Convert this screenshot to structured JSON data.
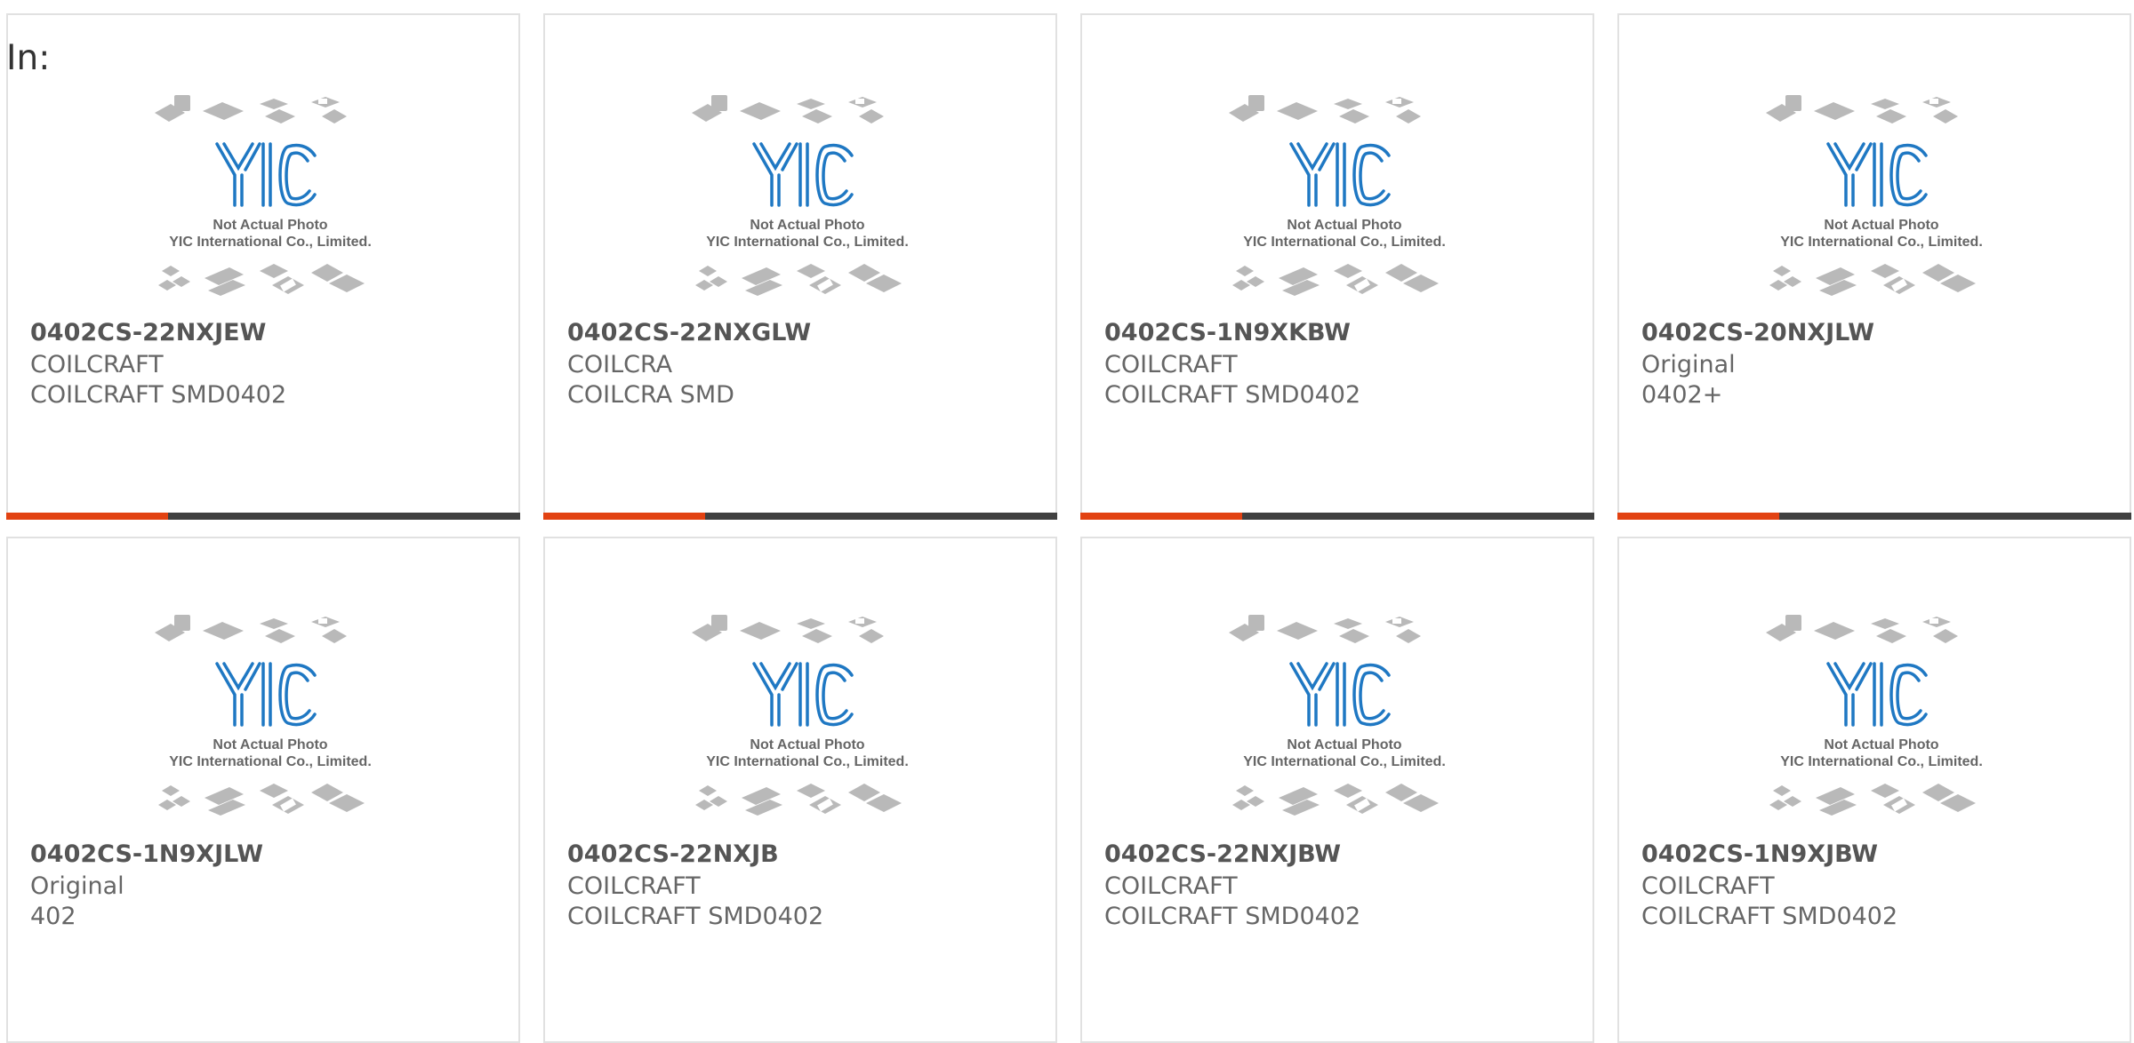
{
  "page": {
    "filter_label": "In:"
  },
  "thumbnail": {
    "line1": "Not Actual Photo",
    "line2": "YIC International Co., Limited.",
    "logo_text": "YIC"
  },
  "colors": {
    "accent": "#e24212",
    "bar_dark": "#404040",
    "logo_blue": "#1f78c3",
    "card_border": "#e1e1e1"
  },
  "products": [
    {
      "part": "0402CS-22NXJEW",
      "brand": "COILCRAFT",
      "package": "COILCRAFT SMD0402"
    },
    {
      "part": "0402CS-22NXGLW",
      "brand": "COILCRA",
      "package": "COILCRA SMD"
    },
    {
      "part": "0402CS-1N9XKBW",
      "brand": "COILCRAFT",
      "package": "COILCRAFT SMD0402"
    },
    {
      "part": "0402CS-20NXJLW",
      "brand": "Original",
      "package": "0402+"
    },
    {
      "part": "0402CS-1N9XJLW",
      "brand": "Original",
      "package": "402"
    },
    {
      "part": "0402CS-22NXJB",
      "brand": "COILCRAFT",
      "package": "COILCRAFT SMD0402"
    },
    {
      "part": "0402CS-22NXJBW",
      "brand": "COILCRAFT",
      "package": "COILCRAFT SMD0402"
    },
    {
      "part": "0402CS-1N9XJBW",
      "brand": "COILCRAFT",
      "package": "COILCRAFT SMD0402"
    }
  ]
}
